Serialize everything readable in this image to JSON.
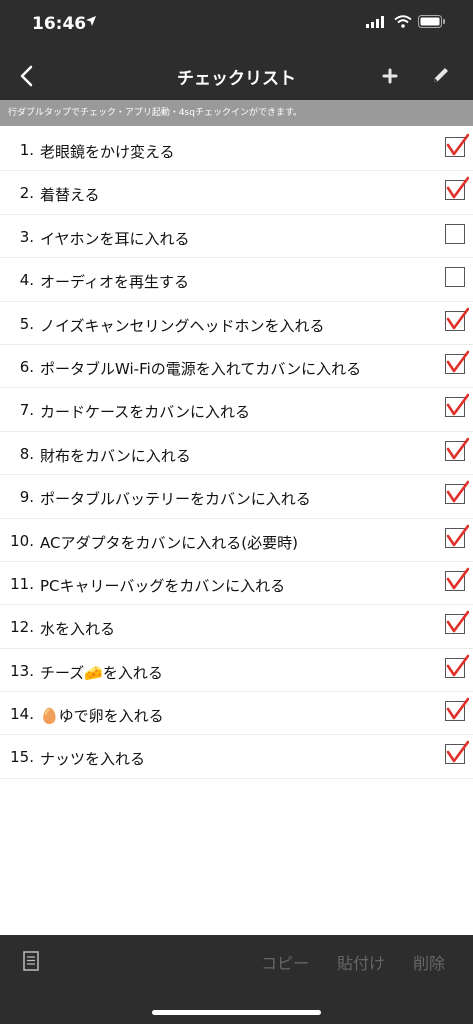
{
  "status": {
    "time": "16:46"
  },
  "nav": {
    "title": "チェックリスト"
  },
  "hint": "行ダブルタップでチェック・アプリ起動・4sqチェックインができます。",
  "items": [
    {
      "num": "1.",
      "text": "老眼鏡をかけ変える",
      "checked": true
    },
    {
      "num": "2.",
      "text": "着替える",
      "checked": true
    },
    {
      "num": "3.",
      "text": "イヤホンを耳に入れる",
      "checked": false
    },
    {
      "num": "4.",
      "text": "オーディオを再生する",
      "checked": false
    },
    {
      "num": "5.",
      "text": "ノイズキャンセリングヘッドホンを入れる",
      "checked": true
    },
    {
      "num": "6.",
      "text": "ポータブルWi-Fiの電源を入れてカバンに入れる",
      "checked": true
    },
    {
      "num": "7.",
      "text": "カードケースをカバンに入れる",
      "checked": true
    },
    {
      "num": "8.",
      "text": "財布をカバンに入れる",
      "checked": true
    },
    {
      "num": "9.",
      "text": "ポータブルバッテリーをカバンに入れる",
      "checked": true
    },
    {
      "num": "10.",
      "text": "ACアダプタをカバンに入れる(必要時)",
      "checked": true
    },
    {
      "num": "11.",
      "text": "PCキャリーバッグをカバンに入れる",
      "checked": true
    },
    {
      "num": "12.",
      "text": "水を入れる",
      "checked": true
    },
    {
      "num": "13.",
      "text": "チーズ🧀を入れる",
      "checked": true
    },
    {
      "num": "14.",
      "text": "🥚ゆで卵を入れる",
      "checked": true
    },
    {
      "num": "15.",
      "text": "ナッツを入れる",
      "checked": true
    }
  ],
  "toolbar": {
    "copy": "コピー",
    "paste": "貼付け",
    "delete": "削除"
  },
  "colors": {
    "bar": "#2d2d2d",
    "hint_bg": "#9a9a9a",
    "check": "#e0302a",
    "disabled_text": "#666666"
  }
}
